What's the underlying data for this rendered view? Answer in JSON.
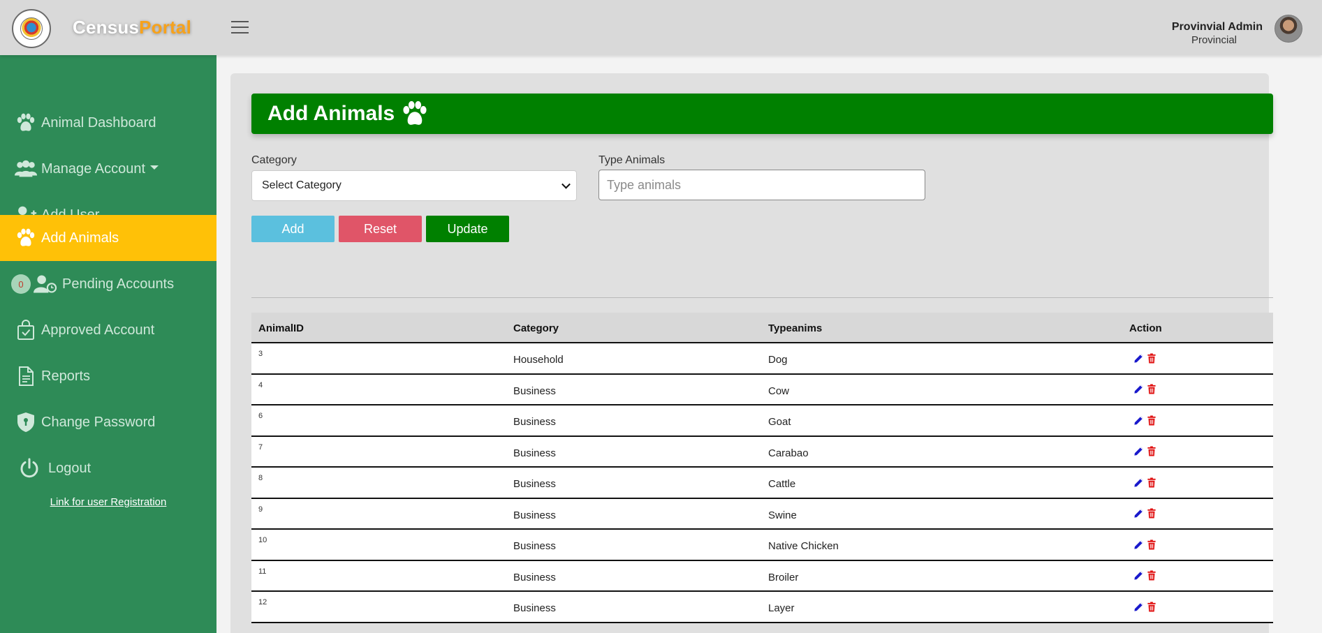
{
  "header": {
    "brand_main": "Census",
    "brand_accent": "Portal",
    "user_name": "Provinvial Admin",
    "user_role": "Provincial"
  },
  "sidebar": {
    "items": [
      {
        "label": "Animal Dashboard",
        "icon": "paw-icon"
      },
      {
        "label": "Manage Account",
        "icon": "users-icon",
        "dropdown": true
      },
      {
        "label": "Add User",
        "icon": "user-plus-icon"
      },
      {
        "label": "Add Animals",
        "icon": "paw-icon",
        "active": true
      },
      {
        "label": "Pending Accounts",
        "icon": "user-clock-icon",
        "badge": "0"
      },
      {
        "label": "Approved Account",
        "icon": "shopping-bag-check-icon"
      },
      {
        "label": "Reports",
        "icon": "file-text-icon"
      },
      {
        "label": "Change Password",
        "icon": "shield-lock-icon"
      },
      {
        "label": "Logout",
        "icon": "power-icon"
      }
    ],
    "registration_link": "Link for user Registration"
  },
  "page": {
    "title": "Add Animals",
    "category_label": "Category",
    "category_value": "Select Category",
    "type_label": "Type Animals",
    "type_placeholder": "Type animals",
    "buttons": {
      "add": "Add",
      "reset": "Reset",
      "update": "Update"
    }
  },
  "table": {
    "headers": {
      "id": "AnimalID",
      "category": "Category",
      "type": "Typeanims",
      "action": "Action"
    },
    "rows": [
      {
        "id": "3",
        "category": "Household",
        "type": "Dog"
      },
      {
        "id": "4",
        "category": "Business",
        "type": "Cow"
      },
      {
        "id": "6",
        "category": "Business",
        "type": "Goat"
      },
      {
        "id": "7",
        "category": "Business",
        "type": "Carabao"
      },
      {
        "id": "8",
        "category": "Business",
        "type": "Cattle"
      },
      {
        "id": "9",
        "category": "Business",
        "type": "Swine"
      },
      {
        "id": "10",
        "category": "Business",
        "type": "Native Chicken"
      },
      {
        "id": "11",
        "category": "Business",
        "type": "Broiler"
      },
      {
        "id": "12",
        "category": "Business",
        "type": "Layer"
      }
    ]
  },
  "colors": {
    "sidebar": "#2e8b57",
    "active": "#ffc107",
    "banner": "#008000",
    "add": "#5bc0de",
    "reset": "#e05568",
    "update": "#008000",
    "edit_icon": "#1a1acc",
    "delete_icon": "#e01010"
  }
}
